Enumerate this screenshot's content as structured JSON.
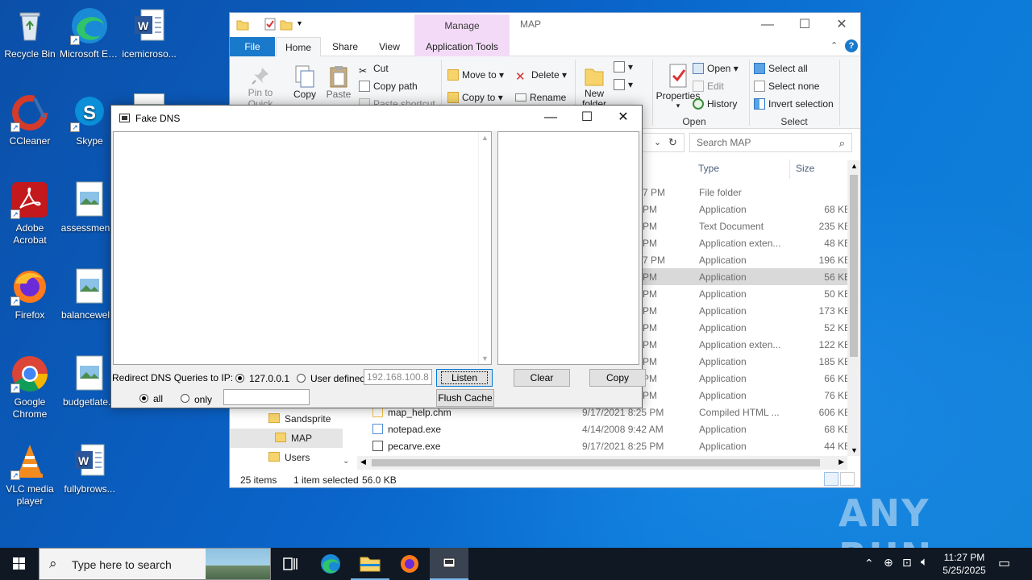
{
  "desktop": {
    "icons": [
      {
        "label": "Recycle Bin"
      },
      {
        "label": "Microsoft Edge"
      },
      {
        "label": "icemicroso..."
      },
      {
        "label": "CCleaner"
      },
      {
        "label": "Skype"
      },
      {
        "label": "Adobe Acrobat"
      },
      {
        "label": "assessmen..."
      },
      {
        "label": "Firefox"
      },
      {
        "label": "balancewel..."
      },
      {
        "label": "Google Chrome"
      },
      {
        "label": "budgetlate..."
      },
      {
        "label": "VLC media player"
      },
      {
        "label": "fullybrows..."
      }
    ]
  },
  "explorer": {
    "title": "MAP",
    "manage_tab": "Manage",
    "tabs": {
      "file": "File",
      "home": "Home",
      "share": "Share",
      "view": "View",
      "app_tools": "Application Tools"
    },
    "ribbon": {
      "pin": "Pin to Quick access",
      "copy": "Copy",
      "paste": "Paste",
      "cut": "Cut",
      "copy_path": "Copy path",
      "paste_shortcut": "Paste shortcut",
      "move_to": "Move to",
      "copy_to": "Copy to",
      "delete": "Delete",
      "rename": "Rename",
      "new_folder": "New folder",
      "properties": "Properties",
      "open": "Open",
      "edit": "Edit",
      "history": "History",
      "select_all": "Select all",
      "select_none": "Select none",
      "invert_selection": "Invert selection",
      "group_open": "Open",
      "group_select": "Select"
    },
    "search_placeholder": "Search MAP",
    "columns": {
      "type": "Type",
      "size": "Size"
    },
    "partial_rows": [
      {
        "date": "7 PM",
        "type": "File folder",
        "size": ""
      },
      {
        "date": "PM",
        "type": "Application",
        "size": "68 KB"
      },
      {
        "date": "PM",
        "type": "Text Document",
        "size": "235 KB"
      },
      {
        "date": "PM",
        "type": "Application exten...",
        "size": "48 KB"
      },
      {
        "date": "7 PM",
        "type": "Application",
        "size": "196 KB"
      },
      {
        "date": "PM",
        "type": "Application",
        "size": "56 KB",
        "selected": true
      },
      {
        "date": "PM",
        "type": "Application",
        "size": "50 KB"
      },
      {
        "date": "PM",
        "type": "Application",
        "size": "173 KB"
      },
      {
        "date": "PM",
        "type": "Application",
        "size": "52 KB"
      },
      {
        "date": "PM",
        "type": "Application exten...",
        "size": "122 KB"
      },
      {
        "date": "PM",
        "type": "Application",
        "size": "185 KB"
      },
      {
        "date": "PM",
        "type": "Application",
        "size": "66 KB"
      },
      {
        "date": "PM",
        "type": "Application",
        "size": "76 KB"
      }
    ],
    "full_rows": [
      {
        "name": "map_help.chm",
        "date": "9/17/2021 8:25 PM",
        "type": "Compiled HTML ...",
        "size": "606 KB"
      },
      {
        "name": "notepad.exe",
        "date": "4/14/2008 9:42 AM",
        "type": "Application",
        "size": "68 KB"
      },
      {
        "name": "pecarve.exe",
        "date": "9/17/2021 8:25 PM",
        "type": "Application",
        "size": "44 KB"
      }
    ],
    "nav": [
      {
        "label": "Sandsprite"
      },
      {
        "label": "MAP",
        "selected": true
      },
      {
        "label": "Users"
      }
    ],
    "status": {
      "items": "25 items",
      "selected": "1 item selected",
      "size": "56.0 KB"
    }
  },
  "fakedns": {
    "title": "Fake DNS",
    "redirect_label": "Redirect DNS Queries to IP:",
    "radio_local": "127.0.0.1",
    "radio_user": "User defined",
    "ip_value": "192.168.100.8",
    "listen": "Listen",
    "clear": "Clear",
    "copy": "Copy",
    "radio_all": "all",
    "radio_only": "only",
    "only_value": "",
    "flush": "Flush Cache"
  },
  "watermark": "ANY RUN",
  "taskbar": {
    "search_placeholder": "Type here to search",
    "time": "11:27 PM",
    "date": "5/25/2025"
  }
}
